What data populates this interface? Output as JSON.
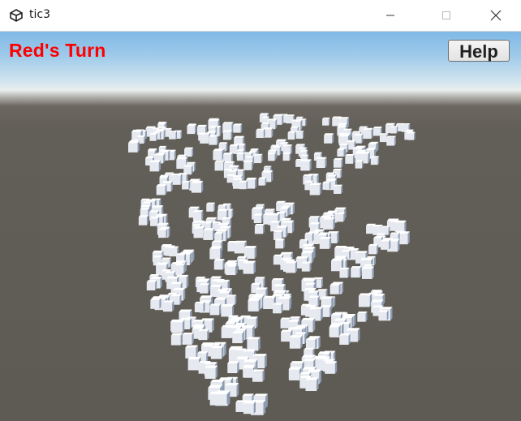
{
  "window": {
    "title": "tic3"
  },
  "hud": {
    "turn_text": "Red's Turn",
    "turn_color": "#ff0000",
    "help_label": "Help"
  },
  "icons": {
    "app": "unity-logo-icon",
    "minimize": "minimize-icon",
    "maximize": "maximize-icon",
    "close": "close-icon"
  },
  "board": {
    "description_type": "3D tic-tac-toe cube grid",
    "layers": 4,
    "cells_per_side": 4,
    "cube_color": "#e9edf3"
  }
}
